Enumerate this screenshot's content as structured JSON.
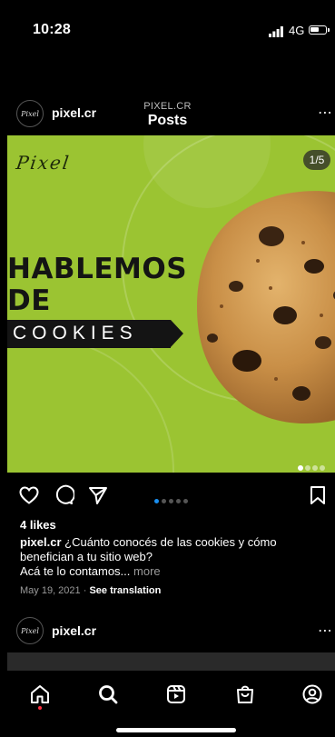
{
  "status_bar": {
    "time": "10:28",
    "network": "4G"
  },
  "header": {
    "account": "PIXEL.CR",
    "title": "Posts"
  },
  "post": {
    "username": "pixel.cr",
    "avatar_text": "Pixel",
    "image": {
      "brand": "Pixel",
      "counter": "1/5",
      "headline_line1": "HABLEMOS",
      "headline_line2": "DE",
      "headline_band": "COOKIES"
    },
    "likes": "4 likes",
    "caption_user": "pixel.cr",
    "caption_text": "¿Cuánto conocés de las cookies y cómo benefician a tu sitio web?",
    "caption_line2": "Acá te lo contamos...",
    "more_label": "more",
    "date": "May 19, 2021",
    "separator": "·",
    "translate_label": "See translation"
  },
  "next_post": {
    "username": "pixel.cr",
    "avatar_text": "Pixel"
  },
  "icons": {
    "back": "chevron-left-icon",
    "more": "more-dots-icon",
    "like": "heart-icon",
    "comment": "comment-icon",
    "share": "send-icon",
    "save": "bookmark-icon",
    "home": "home-icon",
    "search": "search-icon",
    "reels": "reels-icon",
    "shop": "shop-bag-icon",
    "profile": "profile-icon"
  },
  "colors": {
    "image_bg": "#9bc432",
    "accent": "#1a8ff0",
    "notification": "#ff3040"
  }
}
